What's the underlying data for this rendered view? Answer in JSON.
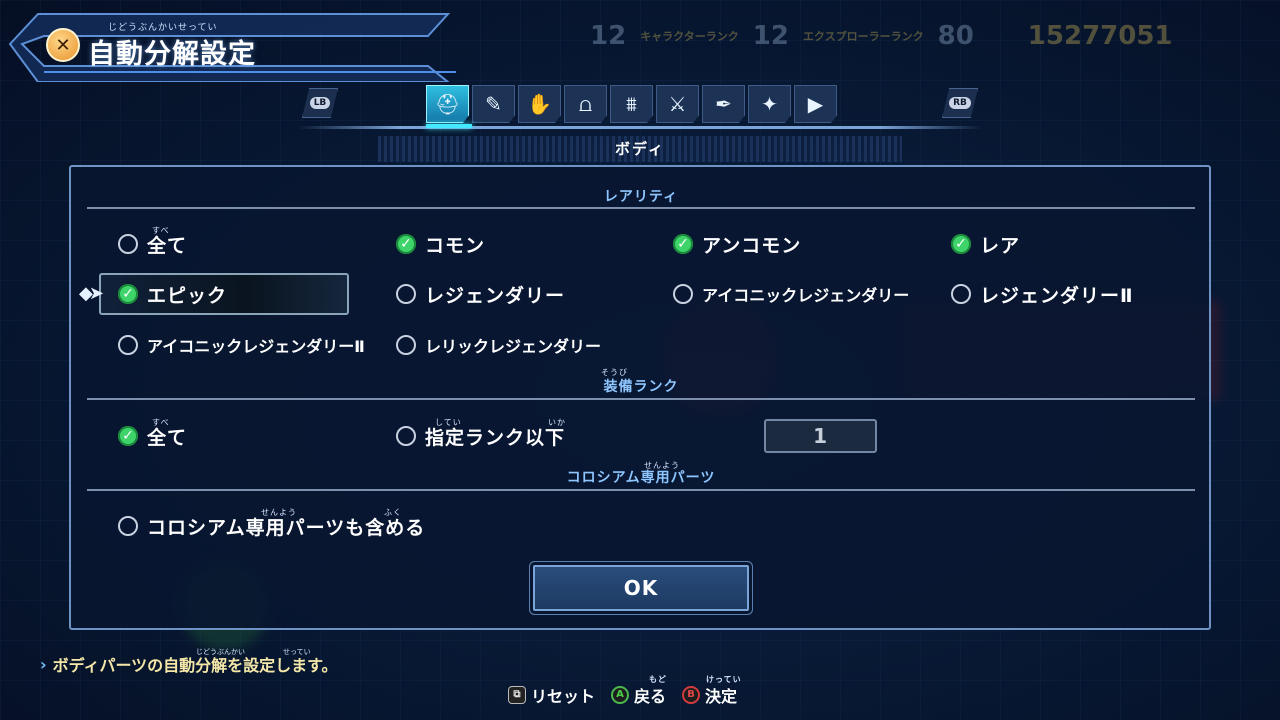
{
  "title": {
    "text": "自動分解設定",
    "ruby": "じどうぶんかいせってい"
  },
  "hud": {
    "player_rank_label": "キャラクターランク",
    "player_rank": "12",
    "explorer_rank_label": "エクスプローラーランク",
    "explorer_rank": "12",
    "percent": "80",
    "money": "15277051"
  },
  "tabs": {
    "lb": "LB",
    "rb": "RB",
    "items": [
      {
        "name": "body-tab",
        "glyph": "⛑",
        "active": true
      },
      {
        "name": "arm-tab",
        "glyph": "✎"
      },
      {
        "name": "hand-tab",
        "glyph": "✋"
      },
      {
        "name": "legs-tab",
        "glyph": "⩍"
      },
      {
        "name": "booster-tab",
        "glyph": "⩩"
      },
      {
        "name": "sword-tab",
        "glyph": "⚔"
      },
      {
        "name": "gun-tab",
        "glyph": "✒"
      },
      {
        "name": "shield-tab",
        "glyph": "✦"
      },
      {
        "name": "play-tab",
        "glyph": "▶"
      }
    ]
  },
  "section_title": "ボディ",
  "rarity": {
    "heading": "レアリティ",
    "all": {
      "label": "全て",
      "ruby": "すべ",
      "checked": false
    },
    "common": {
      "label": "コモン",
      "checked": true
    },
    "uncommon": {
      "label": "アンコモン",
      "checked": true
    },
    "rare": {
      "label": "レア",
      "checked": true
    },
    "epic": {
      "label": "エピック",
      "checked": true
    },
    "legendary": {
      "label": "レジェンダリー",
      "checked": false
    },
    "iconic_legendary": {
      "label": "アイコニックレジェンダリー",
      "checked": false
    },
    "legendary2": {
      "label": "レジェンダリーⅡ",
      "checked": false
    },
    "iconic_legendary2": {
      "label": "アイコニックレジェンダリーⅡ",
      "checked": false
    },
    "relic_legendary": {
      "label": "レリックレジェンダリー",
      "checked": false
    }
  },
  "rank": {
    "heading": "装備ランク",
    "heading_ruby": "そうび",
    "all": {
      "label": "全て",
      "ruby": "すべ",
      "checked": true
    },
    "below": {
      "label": "指定ランク以下",
      "ruby1": "してい",
      "ruby2": "いか",
      "checked": false
    },
    "value": "1"
  },
  "colosseum": {
    "heading": "コロシアム専用パーツ",
    "heading_ruby": "せんよう",
    "include": {
      "label": "コロシアム専用パーツも含める",
      "ruby1": "せんよう",
      "ruby2": "ふく",
      "checked": false
    }
  },
  "ok_label": "OK",
  "help": {
    "text": "ボディパーツの自動分解を設定します。",
    "ruby1": "じどうぶんかい",
    "ruby2": "せってい"
  },
  "footer": {
    "reset": "リセット",
    "back": "戻る",
    "back_ruby": "もど",
    "confirm": "決定",
    "confirm_ruby": "けってい",
    "a_glyph": "A",
    "b_glyph": "B"
  },
  "check_glyph": "✓"
}
